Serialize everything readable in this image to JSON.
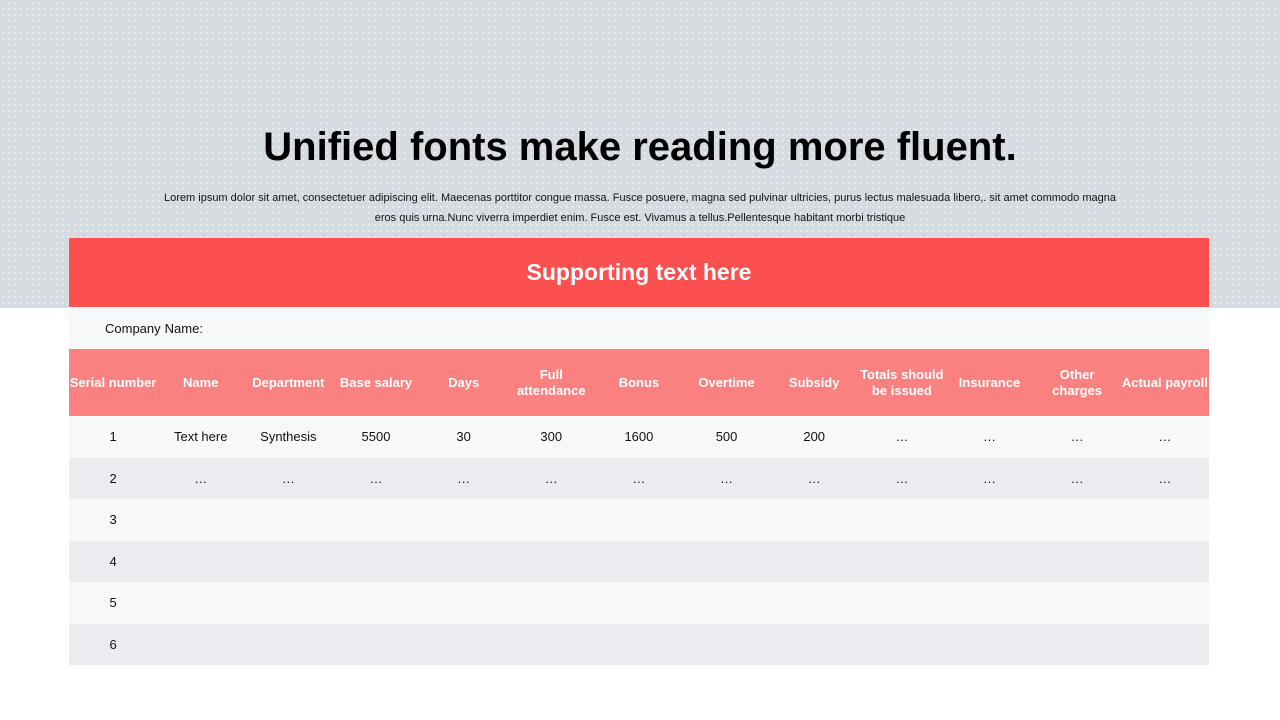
{
  "title": "Unified fonts make reading more fluent.",
  "subtitle": "Lorem ipsum dolor sit amet, consectetuer adipiscing elit. Maecenas porttitor congue massa. Fusce posuere, magna sed pulvinar ultricies, purus lectus malesuada libero,. sit amet commodo magna eros quis urna.Nunc viverra imperdiet enim. Fusce est. Vivamus a tellus.Pellentesque habitant morbi tristique",
  "table": {
    "banner": "Supporting text here",
    "company_label": "Company",
    "company_name_label": "Name:",
    "headers": [
      "Serial number",
      "Name",
      "Department",
      "Base salary",
      "Days",
      "Full attendance",
      "Bonus",
      "Overtime",
      "Subsidy",
      "Totals should be issued",
      "Insurance",
      "Other charges",
      "Actual payroll"
    ],
    "rows": [
      [
        "1",
        "Text here",
        "Synthesis",
        "5500",
        "30",
        "300",
        "1600",
        "500",
        "200",
        "…",
        "…",
        "…",
        "…"
      ],
      [
        "2",
        "…",
        "…",
        "…",
        "…",
        "…",
        "…",
        "…",
        "…",
        "…",
        "…",
        "…",
        "…"
      ],
      [
        "3",
        "",
        "",
        "",
        "",
        "",
        "",
        "",
        "",
        "",
        "",
        "",
        ""
      ],
      [
        "4",
        "",
        "",
        "",
        "",
        "",
        "",
        "",
        "",
        "",
        "",
        "",
        ""
      ],
      [
        "5",
        "",
        "",
        "",
        "",
        "",
        "",
        "",
        "",
        "",
        "",
        "",
        ""
      ],
      [
        "6",
        "",
        "",
        "",
        "",
        "",
        "",
        "",
        "",
        "",
        "",
        "",
        ""
      ]
    ]
  },
  "colors": {
    "banner": "#fc4f4f",
    "header_row": "#fb8080",
    "row_light": "#f7f8fa",
    "row_dark": "#ebecef",
    "top_band": "#d6dbe1"
  }
}
